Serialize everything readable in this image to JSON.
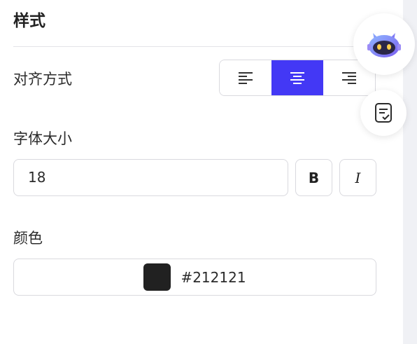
{
  "section": {
    "title": "样式"
  },
  "alignment": {
    "label": "对齐方式",
    "options": [
      {
        "name": "left",
        "icon": "align-left-icon",
        "active": false
      },
      {
        "name": "center",
        "icon": "align-center-icon",
        "active": true
      },
      {
        "name": "right",
        "icon": "align-right-icon",
        "active": false
      }
    ]
  },
  "font_size": {
    "label": "字体大小",
    "value": "18",
    "bold_label": "B",
    "italic_label": "I"
  },
  "color": {
    "label": "颜色",
    "swatch": "#212121",
    "value": "#212121"
  },
  "floating": {
    "assistant_icon": "robot-assistant-icon",
    "notes_icon": "checklist-note-icon"
  },
  "colors": {
    "accent": "#4338f5",
    "border": "#d9d9de",
    "text": "#212121"
  }
}
